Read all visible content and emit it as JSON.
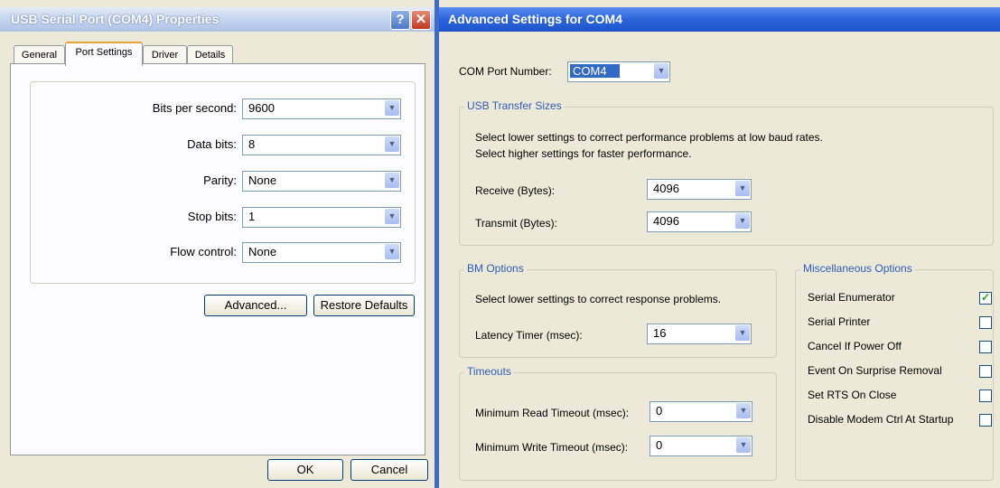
{
  "left_window": {
    "title": "USB Serial Port (COM4) Properties",
    "help_glyph": "?",
    "close_glyph": "✕",
    "tabs": [
      {
        "label": "General"
      },
      {
        "label": "Port Settings"
      },
      {
        "label": "Driver"
      },
      {
        "label": "Details"
      }
    ],
    "active_tab": "Port Settings",
    "fields": [
      {
        "label": "Bits per second:",
        "value": "9600"
      },
      {
        "label": "Data bits:",
        "value": "8"
      },
      {
        "label": "Parity:",
        "value": "None"
      },
      {
        "label": "Stop bits:",
        "value": "1"
      },
      {
        "label": "Flow control:",
        "value": "None"
      }
    ],
    "buttons": {
      "advanced": "Advanced...",
      "restore": "Restore Defaults",
      "ok": "OK",
      "cancel": "Cancel"
    }
  },
  "right_window": {
    "title": "Advanced Settings for COM4",
    "com_port": {
      "label": "COM Port Number:",
      "value": "COM4"
    },
    "usb_transfer": {
      "legend": "USB Transfer Sizes",
      "desc1": "Select lower settings to correct performance problems at low baud rates.",
      "desc2": "Select higher settings for faster performance.",
      "receive": {
        "label": "Receive (Bytes):",
        "value": "4096"
      },
      "transmit": {
        "label": "Transmit (Bytes):",
        "value": "4096"
      }
    },
    "bm_options": {
      "legend": "BM Options",
      "desc": "Select lower settings to correct response problems.",
      "latency": {
        "label": "Latency Timer (msec):",
        "value": "16"
      }
    },
    "timeouts": {
      "legend": "Timeouts",
      "read": {
        "label": "Minimum Read Timeout (msec):",
        "value": "0"
      },
      "write": {
        "label": "Minimum Write Timeout (msec):",
        "value": "0"
      }
    },
    "misc": {
      "legend": "Miscellaneous Options",
      "options": [
        {
          "label": "Serial Enumerator",
          "checked": true
        },
        {
          "label": "Serial Printer",
          "checked": false
        },
        {
          "label": "Cancel If Power Off",
          "checked": false
        },
        {
          "label": "Event On Surprise Removal",
          "checked": false
        },
        {
          "label": "Set RTS On Close",
          "checked": false
        },
        {
          "label": "Disable Modem Ctrl At Startup",
          "checked": false
        }
      ]
    }
  },
  "icons": {
    "dropdown": "chevron-down-icon",
    "check": "checkmark-icon"
  },
  "colors": {
    "titlebar_active": "#2b64da",
    "titlebar_inactive": "#aec3e6",
    "group_label": "#2f5cb8",
    "dialog_bg": "#ece9d8"
  }
}
